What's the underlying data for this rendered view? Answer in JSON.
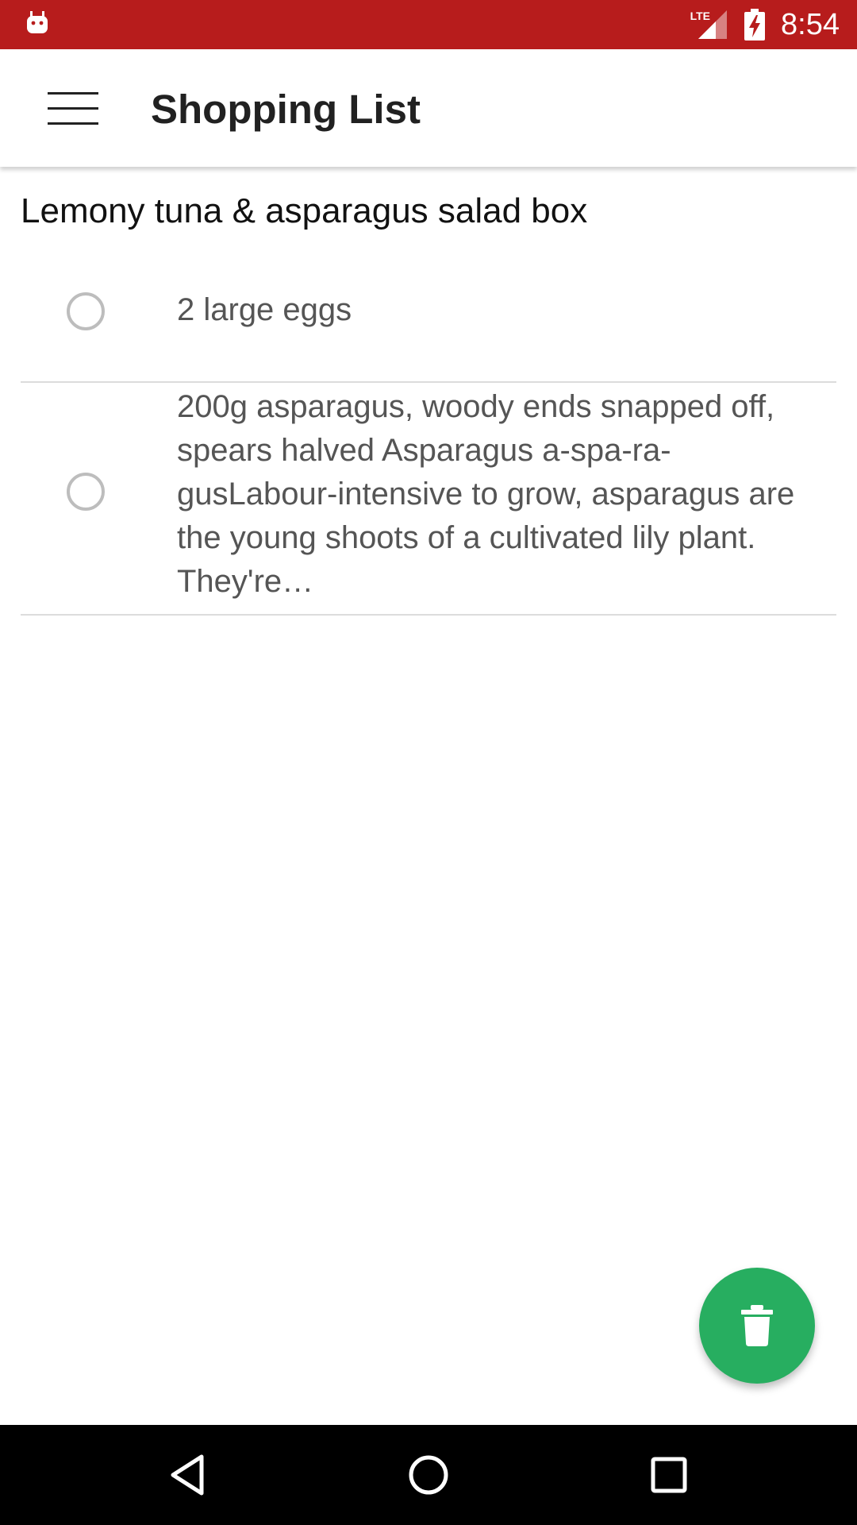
{
  "status_bar": {
    "network_label": "LTE",
    "time": "8:54",
    "icons": [
      "android-icon",
      "signal-icon",
      "battery-charging-icon"
    ]
  },
  "app_bar": {
    "title": "Shopping List",
    "menu_icon": "hamburger-menu-icon"
  },
  "recipe": {
    "title": "Lemony tuna & asparagus salad box",
    "items": [
      {
        "text": "2 large eggs",
        "checked": false
      },
      {
        "text": "200g asparagus, woody ends snapped off, spears halved Asparagus a-spa-ra-gusLabour-intensive to grow, asparagus are the young shoots of a cultivated lily plant. They're…",
        "checked": false
      }
    ]
  },
  "fab": {
    "icon": "trash-icon"
  },
  "nav_bar": {
    "icons": [
      "back-icon",
      "home-icon",
      "recents-icon"
    ]
  },
  "colors": {
    "status_bar": "#b71c1c",
    "fab": "#27ae60",
    "nav_bar": "#000000"
  }
}
